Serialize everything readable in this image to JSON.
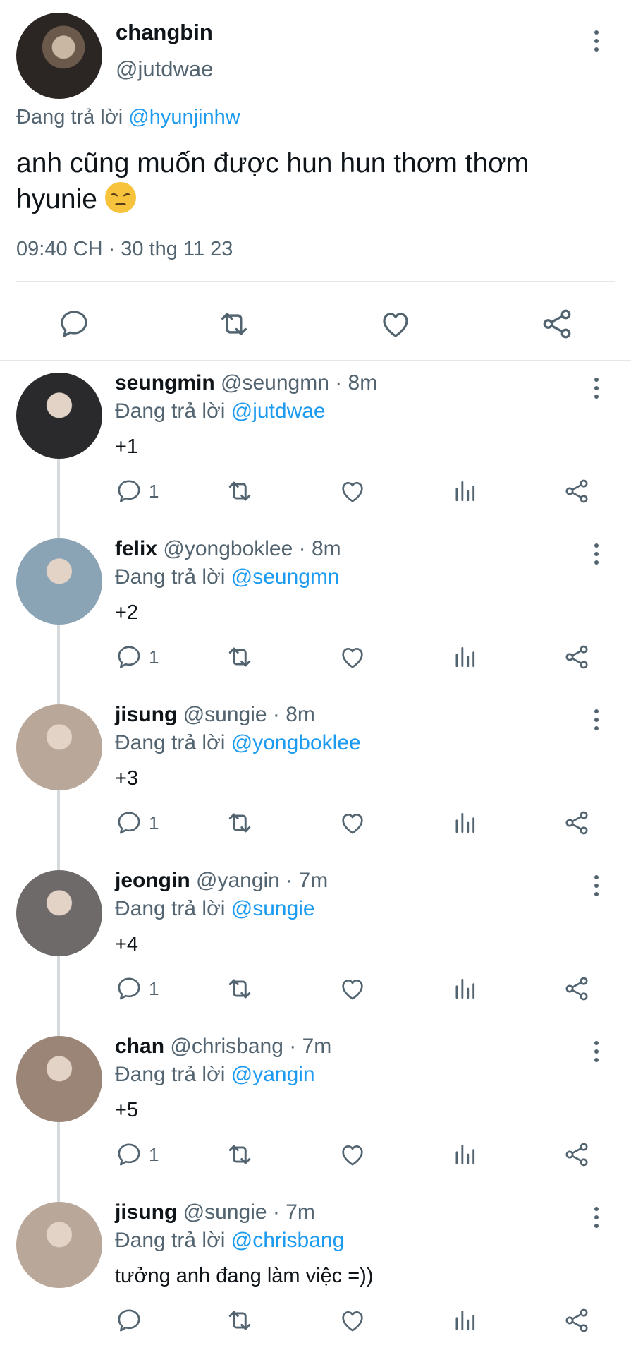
{
  "main_tweet": {
    "name": "changbin",
    "handle": "@jutdwae",
    "replying_prefix": "Đang trả lời",
    "replying_to": "@hyunjinhw",
    "text_line1": "anh cũng muốn được hun hun thơm thơm",
    "text_line2": "hyunie",
    "emoji": "disappointed-face",
    "timestamp": "09:40 CH · 30 thg 11 23",
    "actions": [
      "reply-icon",
      "retweet-icon",
      "like-icon",
      "share-icon"
    ]
  },
  "replies": [
    {
      "name": "seungmin",
      "meta": "@seungmn · 8m",
      "replying_prefix": "Đang trả lời",
      "replying_to": "@jutdwae",
      "text": "+1",
      "reply_count": "1",
      "avatar_color": "#2a2a2c"
    },
    {
      "name": "felix",
      "meta": "@yongboklee · 8m",
      "replying_prefix": "Đang trả lời",
      "replying_to": "@seungmn",
      "text": "+2",
      "reply_count": "1",
      "avatar_color": "#8aa3b5"
    },
    {
      "name": "jisung",
      "meta": "@sungie · 8m",
      "replying_prefix": "Đang trả lời",
      "replying_to": "@yongboklee",
      "text": "+3",
      "reply_count": "1",
      "avatar_color": "#b9a79a"
    },
    {
      "name": "jeongin",
      "meta": "@yangin · 7m",
      "replying_prefix": "Đang trả lời",
      "replying_to": "@sungie",
      "text": "+4",
      "reply_count": "1",
      "avatar_color": "#6e6a6a"
    },
    {
      "name": "chan",
      "meta": "@chrisbang · 7m",
      "replying_prefix": "Đang trả lời",
      "replying_to": "@yangin",
      "text": "+5",
      "reply_count": "1",
      "avatar_color": "#9b8577"
    },
    {
      "name": "jisung",
      "meta": "@sungie · 7m",
      "replying_prefix": "Đang trả lời",
      "replying_to": "@chrisbang",
      "text": "tưởng anh đang làm việc =))",
      "reply_count": "",
      "avatar_color": "#b9a79a"
    }
  ],
  "colors": {
    "accent": "#1d9bf0",
    "secondary_text": "#536471",
    "divider": "#e3e7ea"
  }
}
